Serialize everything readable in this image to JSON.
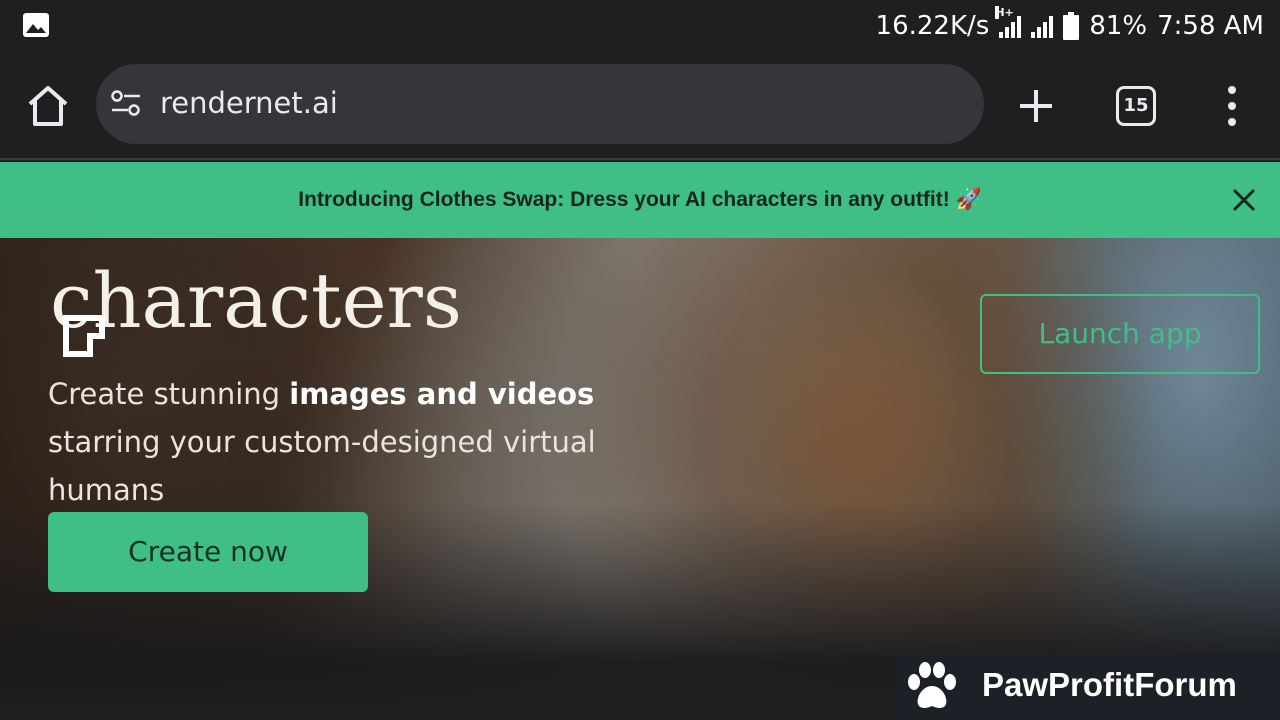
{
  "status_bar": {
    "network_speed": "16.22K/s",
    "network_type": "H+",
    "battery_percent": "81%",
    "time": "7:58 AM",
    "icons": [
      "image-icon",
      "signal-icon",
      "signal-icon",
      "battery-icon"
    ]
  },
  "browser": {
    "url": "rendernet.ai",
    "tab_count": "15",
    "icons": [
      "home-icon",
      "site-settings-icon",
      "plus-icon",
      "tabs-icon",
      "more-vert-icon"
    ]
  },
  "banner": {
    "text": "Introducing Clothes Swap: Dress your AI characters in any outfit! 🚀",
    "close_icon": "close-icon",
    "color": "#3fbf86"
  },
  "hero": {
    "title": "characters",
    "subtitle_pre": "Create stunning ",
    "subtitle_bold": "images and videos",
    "subtitle_post": " starring your custom-designed virtual humans",
    "create_button": "Create now",
    "launch_button": "Launch app",
    "accent_color": "#3fbf86"
  },
  "watermark": {
    "text": "PawProfitForum",
    "icon": "paw-icon"
  }
}
